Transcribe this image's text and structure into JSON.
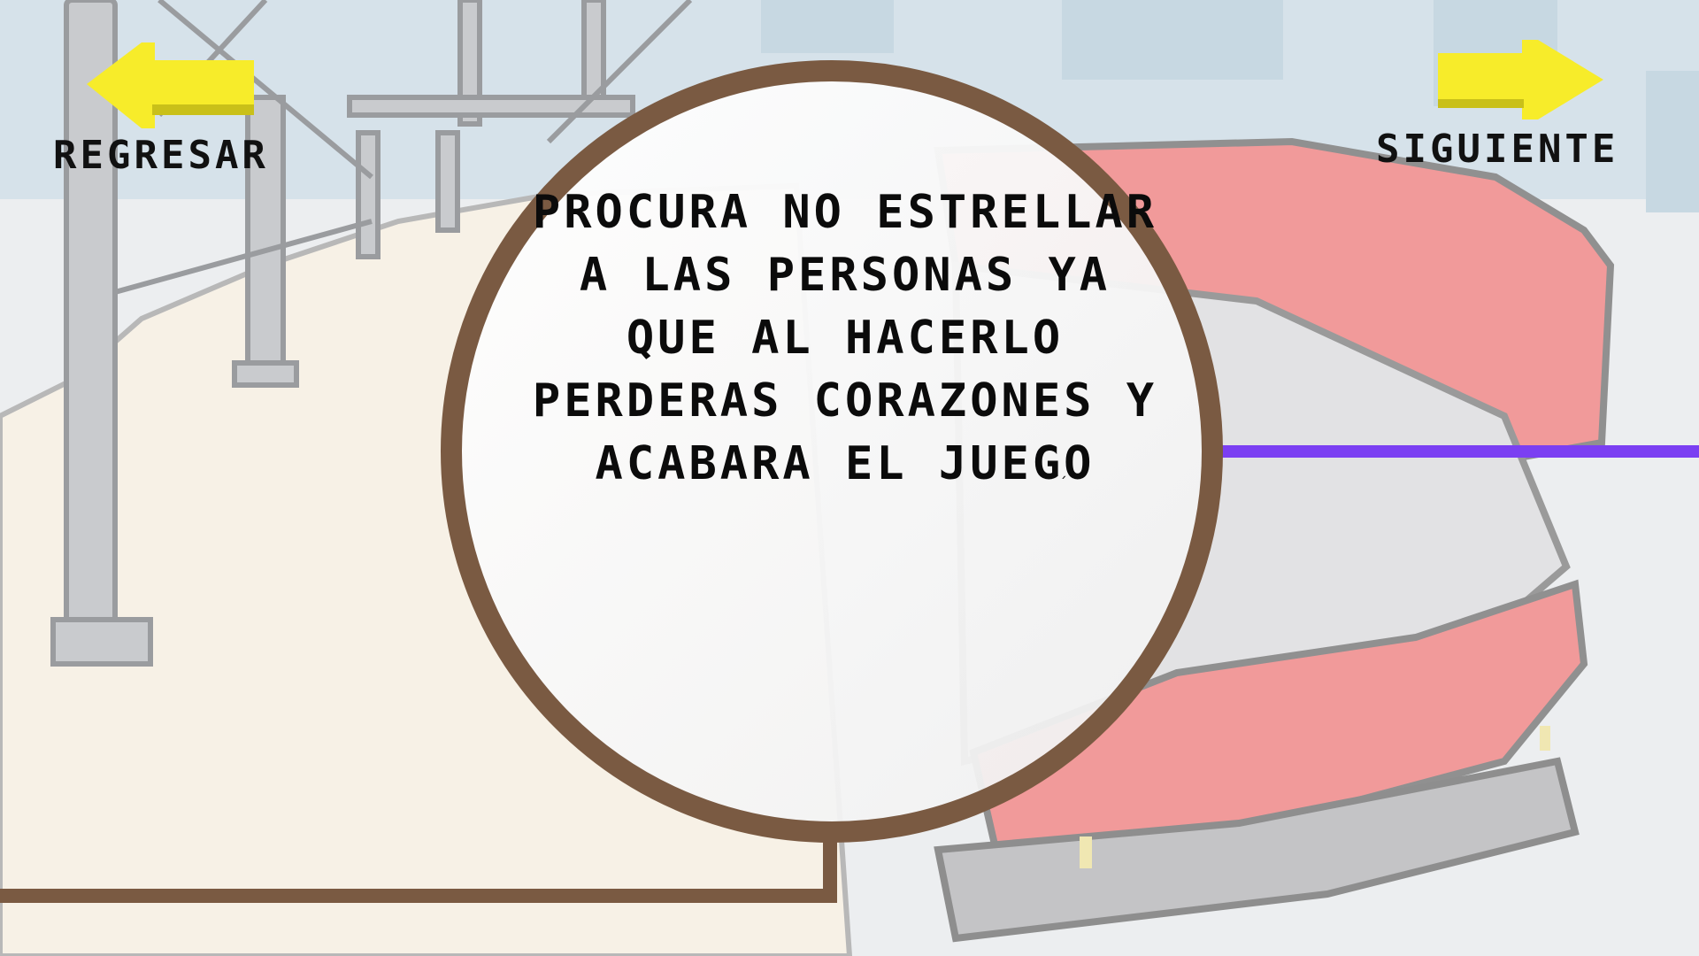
{
  "navigation": {
    "back_label": "Regresar",
    "next_label": "Siguiente",
    "arrow_color": "#f7ec2a"
  },
  "dialog": {
    "message": "Procura no estrellar a las personas ya que al hacerlo perderas corazones y acabara el juego",
    "accent_mark": "´",
    "border_color": "#7a5a42"
  },
  "scene": {
    "bus_color": "#f19a9a",
    "guide_line_color": "#7b3ff2"
  }
}
